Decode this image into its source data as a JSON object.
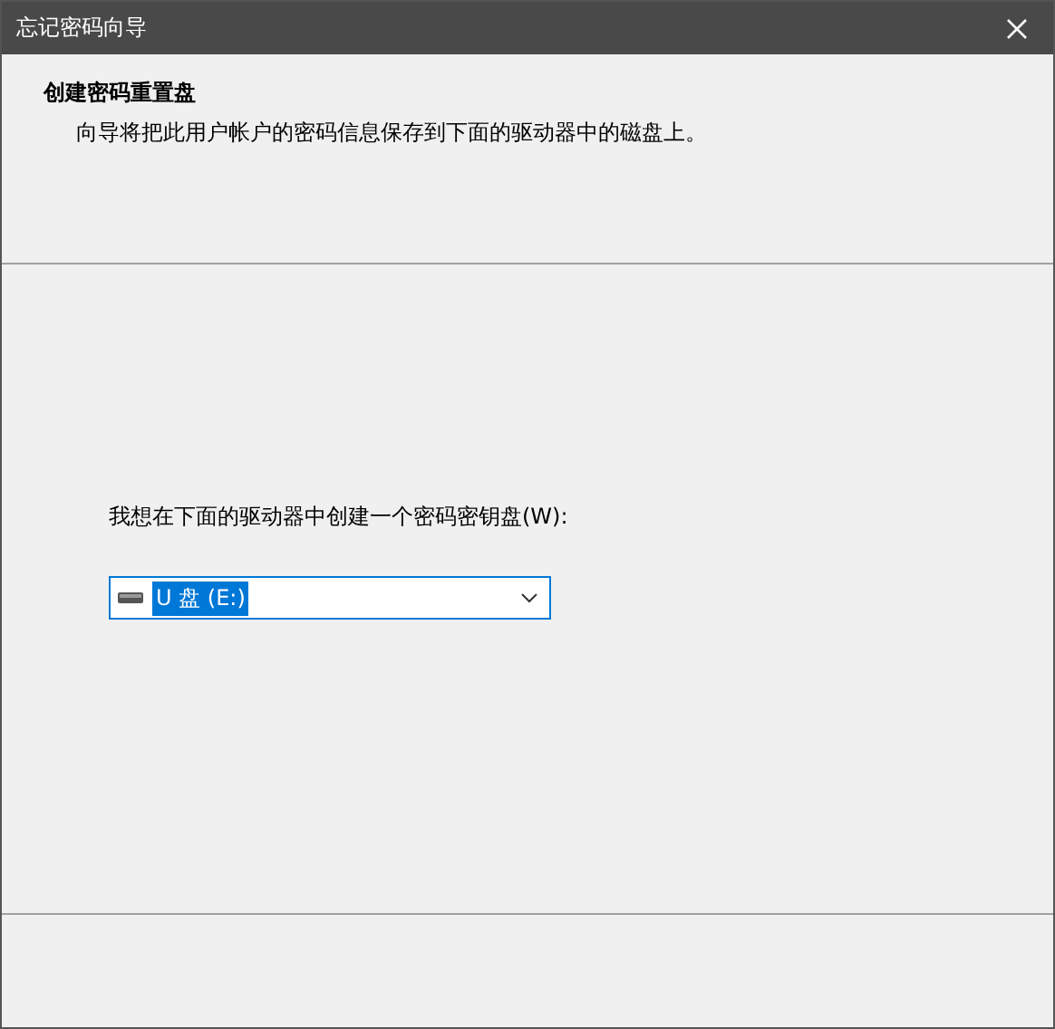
{
  "window": {
    "title": "忘记密码向导"
  },
  "header": {
    "title": "创建密码重置盘",
    "subtitle": "向导将把此用户帐户的密码信息保存到下面的驱动器中的磁盘上。"
  },
  "drive_select": {
    "label": "我想在下面的驱动器中创建一个密码密钥盘(W):",
    "value": "U 盘 (E:)",
    "highlighted": true
  }
}
